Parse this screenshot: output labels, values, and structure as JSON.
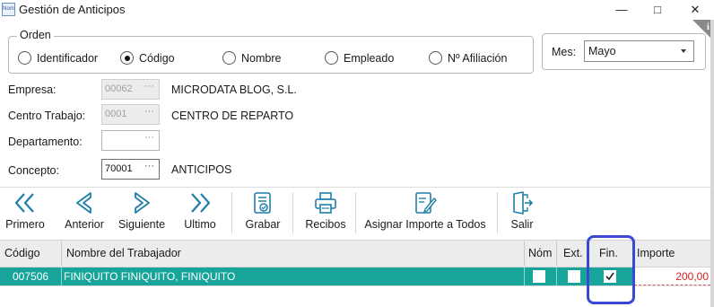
{
  "window": {
    "app_icon_text": "Nom",
    "title": "Gestión de Anticipos",
    "minimize_glyph": "—",
    "maximize_glyph": "□",
    "close_glyph": "✕"
  },
  "orden": {
    "legend": "Orden",
    "options": [
      {
        "label": "Identificador",
        "selected": false
      },
      {
        "label": "Código",
        "selected": true
      },
      {
        "label": "Nombre",
        "selected": false
      },
      {
        "label": "Empleado",
        "selected": false
      },
      {
        "label": "Nº Afiliación",
        "selected": false
      }
    ]
  },
  "mes": {
    "label": "Mes:",
    "value": "Mayo"
  },
  "fields": {
    "empresa": {
      "label": "Empresa:",
      "code": "00062",
      "name": "MICRODATA BLOG, S.L."
    },
    "centro": {
      "label": "Centro Trabajo:",
      "code": "0001",
      "name": "CENTRO DE REPARTO"
    },
    "departamento": {
      "label": "Departamento:",
      "code": "",
      "name": ""
    },
    "concepto": {
      "label": "Concepto:",
      "code": "70001",
      "name": "ANTICIPOS"
    },
    "lookup_glyph": "···"
  },
  "toolbar": {
    "primero": "Primero",
    "anterior": "Anterior",
    "siguiente": "Siguiente",
    "ultimo": "Ultimo",
    "grabar": "Grabar",
    "recibos": "Recibos",
    "asignar": "Asignar Importe a Todos",
    "salir": "Salir"
  },
  "grid": {
    "headers": {
      "codigo": "Código",
      "nombre": "Nombre del Trabajador",
      "nom": "Nóm",
      "ext": "Ext.",
      "fin": "Fin.",
      "importe": "Importe"
    },
    "rows": [
      {
        "codigo": "007506",
        "nombre": "FINIQUITO FINIQUITO, FINIQUITO",
        "nom": false,
        "ext": false,
        "fin": true,
        "importe": "200,00"
      }
    ]
  },
  "colors": {
    "row_selected": "#17a49b",
    "accent_icons": "#1f7fa8",
    "highlight": "#3a48d4",
    "importe_text": "#d61f1f"
  }
}
